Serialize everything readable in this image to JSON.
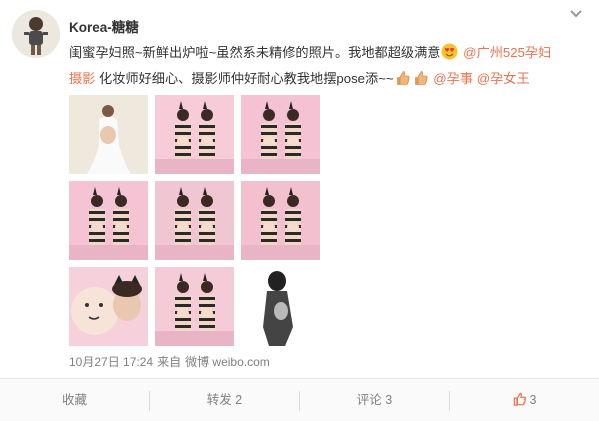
{
  "post": {
    "username": "Korea-糖糖",
    "text_line1": "闺蜜孕妇照~新鲜出炉啦~虽然系未精修的照片。我地都超级满意",
    "mention1_part1": "@广州525孕妇",
    "mention1_part2": "摄影",
    "text_line2": "化妆师好细心、摄影师仲好耐心教我地摆pose添~~",
    "mention2": "@孕事",
    "mention3": "@孕女王",
    "timestamp": "10月27日 17:24",
    "source_prefix": "来自",
    "source": "微博 weibo.com",
    "photos": [
      {
        "bg": "#efe8dd",
        "figure": "#7a5a45",
        "dress": "#fafafa"
      },
      {
        "bg": "#f7cbd8",
        "figure": "#3b2a24",
        "dress": "#2a2a2a"
      },
      {
        "bg": "#f5c2d3",
        "figure": "#3b2a24",
        "dress": "#2a2a2a"
      },
      {
        "bg": "#f4c4d4",
        "figure": "#3b2a24",
        "dress": "#2a2a2a"
      },
      {
        "bg": "#f0c6d2",
        "figure": "#3b2a24",
        "dress": "#2a2a2a"
      },
      {
        "bg": "#f3c0d0",
        "figure": "#3b2a24",
        "dress": "#2a2a2a"
      },
      {
        "bg": "#f6d0da",
        "figure": "#3b2a24",
        "dress": "#2a2a2a"
      },
      {
        "bg": "#f4cbd6",
        "figure": "#3b2a24",
        "dress": "#2a2a2a"
      },
      {
        "bg": "#ffffff",
        "figure": "#222222",
        "dress": "#444444"
      }
    ]
  },
  "actions": {
    "collect": "收藏",
    "repost": "转发 2",
    "comment": "评论 3",
    "like_count": "3"
  },
  "colors": {
    "link": "#eb7350",
    "meta": "#808080",
    "accent": "#eb7350"
  }
}
